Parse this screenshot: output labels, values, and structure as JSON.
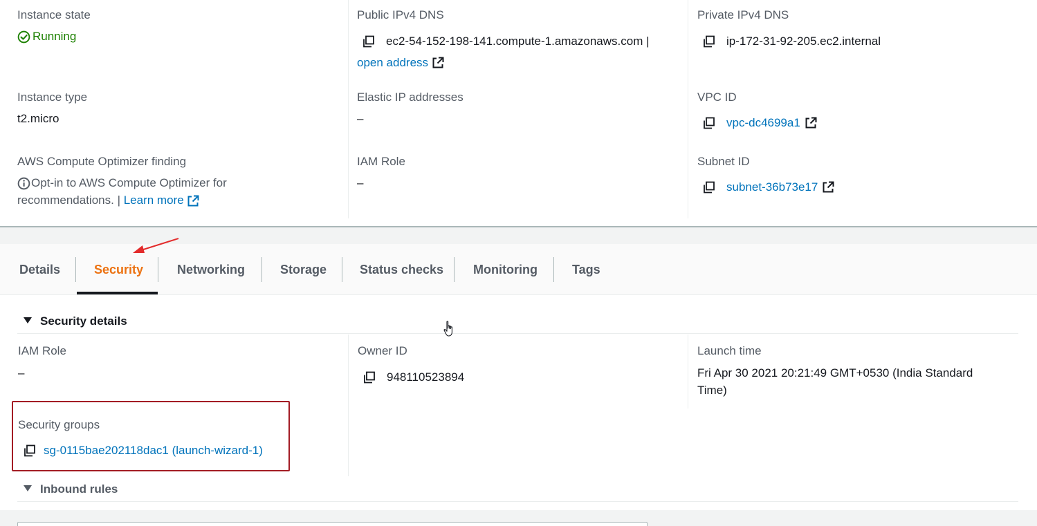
{
  "summary": {
    "instance_state": {
      "label": "Instance state",
      "value": "Running"
    },
    "public_dns": {
      "label": "Public IPv4 DNS",
      "value": "ec2-54-152-198-141.compute-1.amazonaws.com |",
      "link": "open address"
    },
    "private_dns": {
      "label": "Private IPv4 DNS",
      "value": "ip-172-31-92-205.ec2.internal"
    },
    "instance_type": {
      "label": "Instance type",
      "value": "t2.micro"
    },
    "elastic_ip": {
      "label": "Elastic IP addresses",
      "value": "–"
    },
    "vpc_id": {
      "label": "VPC ID",
      "value": "vpc-dc4699a1"
    },
    "optimizer": {
      "label": "AWS Compute Optimizer finding",
      "text_line1": "Opt-in to AWS Compute Optimizer for",
      "text_line2": "recommendations. |",
      "link": "Learn more"
    },
    "iam_role": {
      "label": "IAM Role",
      "value": "–"
    },
    "subnet_id": {
      "label": "Subnet ID",
      "value": "subnet-36b73e17"
    }
  },
  "tabs": [
    {
      "label": "Details",
      "active": false
    },
    {
      "label": "Security",
      "active": true
    },
    {
      "label": "Networking",
      "active": false
    },
    {
      "label": "Storage",
      "active": false
    },
    {
      "label": "Status checks",
      "active": false
    },
    {
      "label": "Monitoring",
      "active": false
    },
    {
      "label": "Tags",
      "active": false
    }
  ],
  "security_details": {
    "header": "Security details",
    "iam_role": {
      "label": "IAM Role",
      "value": "–"
    },
    "owner_id": {
      "label": "Owner ID",
      "value": "948110523894"
    },
    "launch_time": {
      "label": "Launch time",
      "line1": "Fri Apr 30 2021 20:21:49 GMT+0530 (India Standard",
      "line2": "Time)"
    },
    "security_groups": {
      "label": "Security groups",
      "value": "sg-0115bae202118dac1 (launch-wizard-1)"
    }
  },
  "inbound_rules": {
    "header": "Inbound rules"
  },
  "colors": {
    "accent": "#ec7211",
    "link": "#0073bb",
    "success": "#1d8102",
    "highlight": "#a31c24",
    "annotation_arrow": "#e32b2b"
  },
  "icons": [
    "status-ok-icon",
    "copy-icon",
    "external-link-icon",
    "info-icon",
    "caret-down-icon",
    "annotation-arrow-icon",
    "hand-cursor-icon"
  ]
}
